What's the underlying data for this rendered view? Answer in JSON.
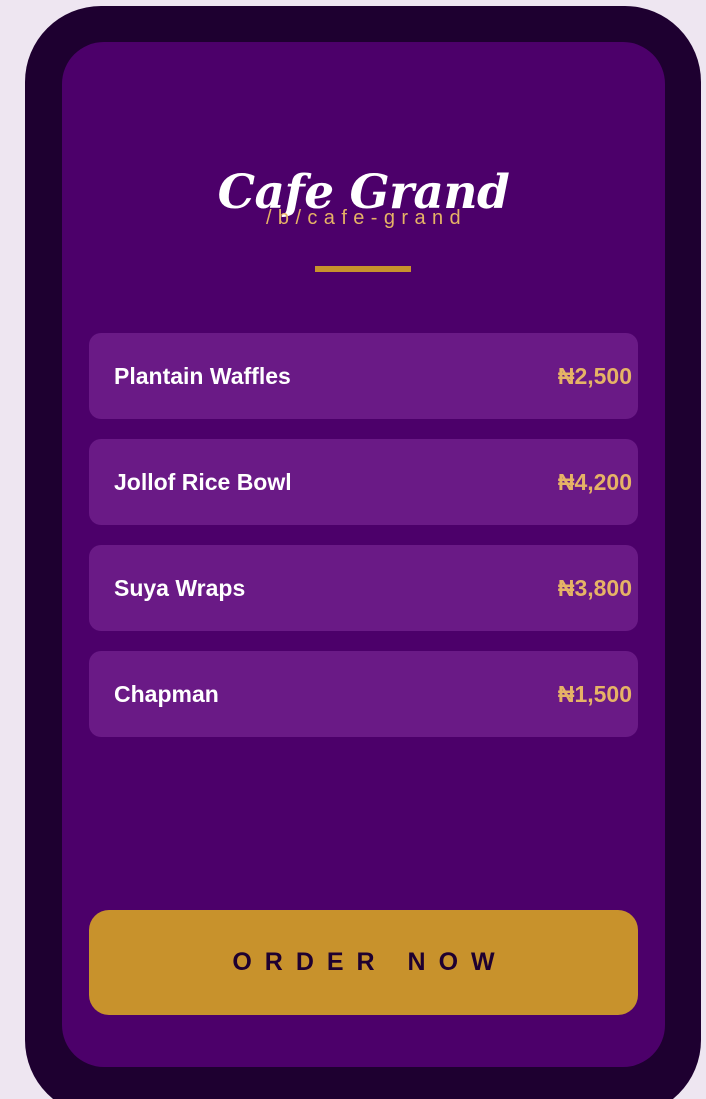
{
  "business": {
    "name": "Cafe Grand",
    "slug": "/b/cafe-grand"
  },
  "menu": {
    "items": [
      {
        "name": "Plantain Waffles",
        "price": "₦2,500"
      },
      {
        "name": "Jollof Rice Bowl",
        "price": "₦4,200"
      },
      {
        "name": "Suya Wraps",
        "price": "₦3,800"
      },
      {
        "name": "Chapman",
        "price": "₦1,500"
      }
    ]
  },
  "cta": {
    "label": "ORDER NOW"
  },
  "colors": {
    "frame": "#1e0030",
    "screen": "#4c006a",
    "card": "#6a1a86",
    "accent": "#c8922c",
    "price_text": "#e6b366",
    "title_text": "#ffffff"
  }
}
